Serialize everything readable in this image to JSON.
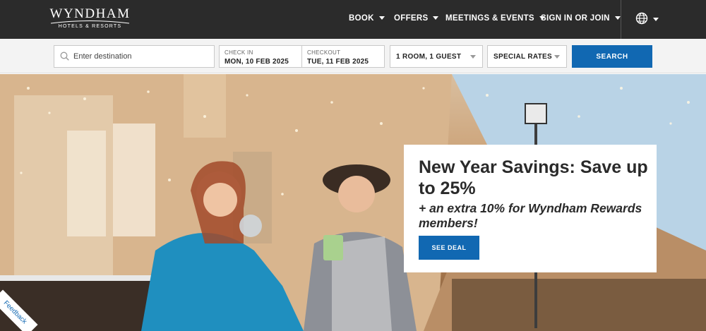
{
  "brand": {
    "name": "WYNDHAM",
    "subtitle": "HOTELS & RESORTS"
  },
  "nav": {
    "items": [
      {
        "label": "BOOK"
      },
      {
        "label": "OFFERS"
      },
      {
        "label": "MEETINGS & EVENTS"
      },
      {
        "label": "SIGN IN OR JOIN"
      }
    ],
    "language_icon": "globe-icon"
  },
  "search": {
    "destination_placeholder": "Enter destination",
    "checkin_label": "CHECK IN",
    "checkin_value": "MON, 10 FEB 2025",
    "checkout_label": "CHECKOUT",
    "checkout_value": "TUE, 11 FEB 2025",
    "rooms_value": "1 ROOM, 1 GUEST",
    "rates_value": "SPECIAL RATES",
    "button_label": "SEARCH"
  },
  "promo": {
    "headline": "New Year Savings: Save up to 25%",
    "subline": "+ an extra 10% for Wyndham Rewards members!",
    "button_label": "SEE DEAL"
  },
  "feedback_label": "Feedback",
  "colors": {
    "nav_bg": "#2b2b2b",
    "accent_blue": "#1168b2",
    "search_bar_bg": "#f3f3f3"
  }
}
